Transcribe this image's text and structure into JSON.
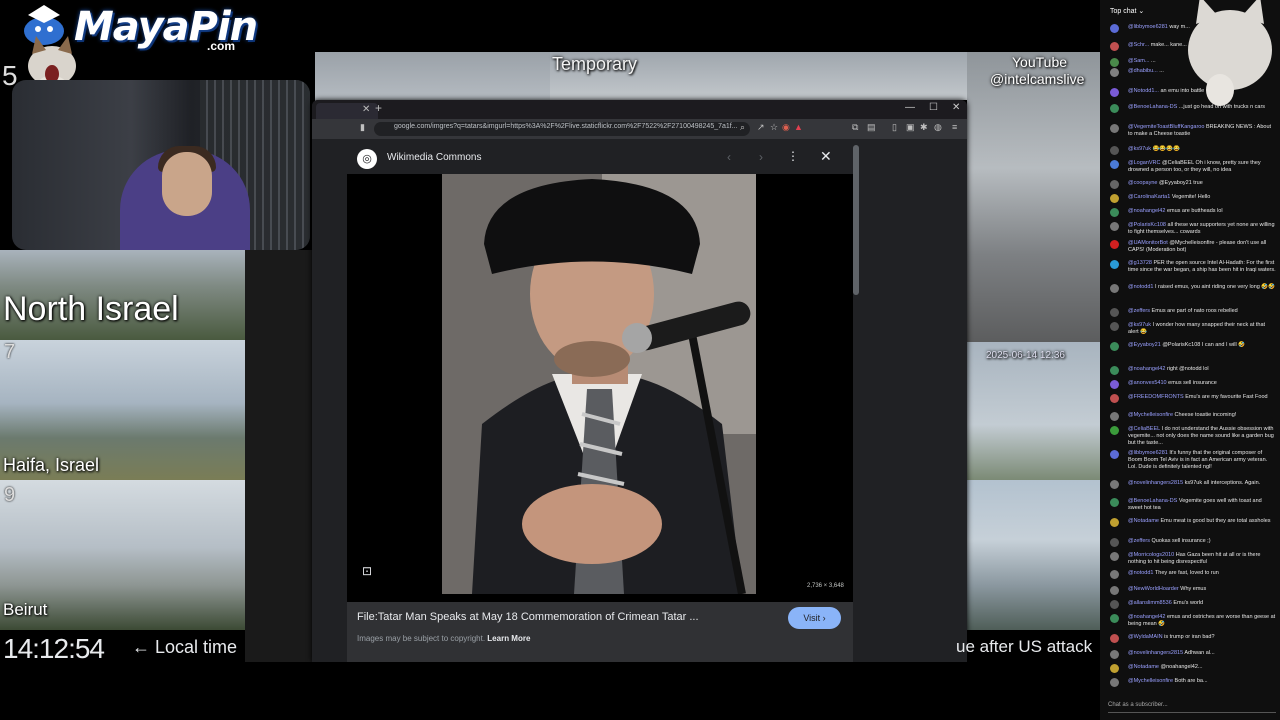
{
  "overlay": {
    "logo_text": "MayaPin",
    "logo_domain": ".com",
    "tile_temporary": "Temporary",
    "youtube_line1": "YouTube",
    "youtube_line2": "@intelcamslive",
    "north_israel": "North Israel",
    "haifa": "Haifa, Israel",
    "beirut": "Beirut",
    "num_5": "5",
    "num_7": "7",
    "num_9": "9",
    "cam_timestamp": "2025-06-14 12:36",
    "clock": "14:12:54",
    "local_time": "← Local time",
    "headline": "ue after US attack"
  },
  "browser": {
    "url": "google.com/imgres?q=tatars&imgurl=https%3A%2F%2Flive.staticflickr.com%2F7522%2F27100498245_7a1f...",
    "source_name": "Wikimedia Commons",
    "image_size": "2,736 × 3,648",
    "caption": "File:Tatar Man Speaks at May 18 Commemoration of Crimean Tatar ...",
    "visit_label": "Visit",
    "copyright_text": "Images may be subject to copyright.",
    "learn_more": "Learn More"
  },
  "chat": {
    "header": "Top chat",
    "input_placeholder": "Chat as a subscriber...",
    "messages": [
      {
        "user": "@libbymoe6281",
        "text": "way m...",
        "color": "#5b6bd6"
      },
      {
        "user": "@Schr...",
        "text": "make... kane...",
        "color": "#c05050"
      },
      {
        "user": "@Sam...",
        "text": "...",
        "color": "#4a8a4a"
      },
      {
        "user": "@dhabibu...",
        "text": "...",
        "color": "#808080"
      },
      {
        "user": "@Notodd1...",
        "text": "an emu into battle",
        "color": "#7a5bd6"
      },
      {
        "user": "@BenoeLahana-DS",
        "text": "...just go head on with trucks n cars",
        "color": "#3b8c5a"
      },
      {
        "user": "@VegemiteToastBluffKangaroo",
        "text": "BREAKING NEWS : About to make a Cheese toastie",
        "color": "#777"
      },
      {
        "user": "@ks97uk",
        "text": "😂😂😂😂",
        "color": "#555"
      },
      {
        "user": "@LoganVRC",
        "text": "@CeliaBEEL Oh i know, pretty sure they drowned a person too, or they will, no idea",
        "color": "#4a7ad6"
      },
      {
        "user": "@coopayne",
        "text": "@Eyyaboy21 true",
        "color": "#666"
      },
      {
        "user": "@CarolinaKarta1",
        "text": "Vegemite! Hello",
        "color": "#c0a030"
      },
      {
        "user": "@noahangel42",
        "text": "emus are buttheads lol",
        "color": "#3b8c5a"
      },
      {
        "user": "@PolarisKc108",
        "text": "all these war supporters yet none are willing to fight themselves... cowards",
        "color": "#777"
      },
      {
        "user": "@UAMonitorBot",
        "text": "@Mychelleisonfire - please don't use all CAPS! (Moderation bot)",
        "color": "#d02020"
      },
      {
        "user": "@g13728",
        "text": "PER the open source Intel Al-Hadath: For the first time since the war began, a ship has been hit in Iraqi waters.",
        "color": "#2a9ad6"
      },
      {
        "user": "@notodd1",
        "text": "I raised emus, you aint riding one very long 🤣🤣",
        "color": "#777"
      },
      {
        "user": "@zeffers",
        "text": "Emus are part of nato roos rebelled",
        "color": "#555"
      },
      {
        "user": "@ks97uk",
        "text": "I wonder how many snapped their neck at that alert 😂",
        "color": "#555"
      },
      {
        "user": "@Eyyaboy21",
        "text": "@PolarisKc108 I can and I will 🤣",
        "color": "#3b8c5a"
      },
      {
        "user": "@noahangel42",
        "text": "right @notodd lol",
        "color": "#3b8c5a"
      },
      {
        "user": "@anonvex5410",
        "text": "emus sell insurance",
        "color": "#7a5bd6"
      },
      {
        "user": "@FREEDOMFRONTS",
        "text": "Emu's are my favourite Fast Food",
        "color": "#c05050"
      },
      {
        "user": "@Mychelleisonfire",
        "text": "Cheese toastie incoming!",
        "color": "#777"
      },
      {
        "user": "@CeliaBEEL",
        "text": "I do not understand the Aussie obsession with vegemite... not only does the name sound like a garden bug but the taste...",
        "color": "#3b9c3b"
      },
      {
        "user": "@libbymoe6281",
        "text": "It's funny that the original composer of Boom Boom Tel Aviv is in fact an American army veteran. Lol. Dude is definitely talented ngl!",
        "color": "#5b6bd6"
      },
      {
        "user": "@novelinhangers2815",
        "text": "ks97uk all interceptions. Again.",
        "color": "#777"
      },
      {
        "user": "@BenoeLahana-DS",
        "text": "Vegemite goes well with toast and sweet hot tea",
        "color": "#3b8c5a"
      },
      {
        "user": "@Notadame",
        "text": "Emu meat is good but they are total assholes",
        "color": "#c0a030"
      },
      {
        "user": "@zeffers",
        "text": "Quokas sell insurance ;)",
        "color": "#555"
      },
      {
        "user": "@Morricologs2010",
        "text": "Has Gaza been hit at all or is there nothing to hit being disrespectful",
        "color": "#777"
      },
      {
        "user": "@notodd1",
        "text": "They are fast, loved to run",
        "color": "#777"
      },
      {
        "user": "@NewWorldHoarder",
        "text": "Why emus",
        "color": "#777"
      },
      {
        "user": "@allanslimm8536",
        "text": "Emu's world",
        "color": "#555"
      },
      {
        "user": "@noahangel42",
        "text": "emus and ostriches are worse than geese at being mean 🤣",
        "color": "#3b8c5a"
      },
      {
        "user": "@WyldaMAIN",
        "text": "is trump or iran bad?",
        "color": "#c05050"
      },
      {
        "user": "@novelinhangers2815",
        "text": "Adhwan al...",
        "color": "#777"
      },
      {
        "user": "@Notadame",
        "text": "@noahangel42...",
        "color": "#c0a030"
      },
      {
        "user": "@Mychelleisonfire",
        "text": "Both are ba...",
        "color": "#777"
      }
    ]
  }
}
